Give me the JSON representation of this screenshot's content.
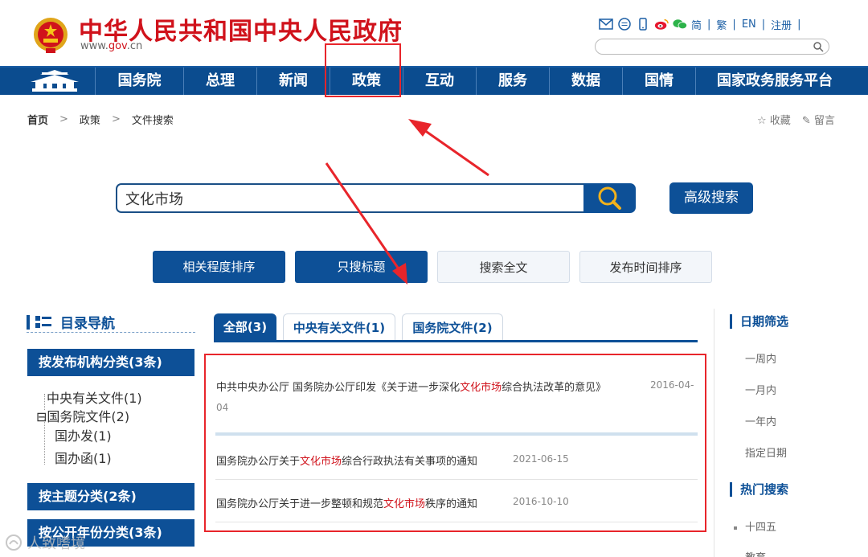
{
  "header": {
    "title": "中华人民共和国中央人民政府",
    "url_prefix": "www.",
    "url_brand": "gov",
    "url_suffix": ".cn",
    "links": {
      "simplified": "简",
      "traditional": "繁",
      "english": "EN",
      "register": "注册"
    },
    "sep": "|",
    "search_placeholder": ""
  },
  "nav": {
    "items": [
      "国务院",
      "总理",
      "新闻",
      "政策",
      "互动",
      "服务",
      "数据",
      "国情",
      "国家政务服务平台"
    ]
  },
  "breadcrumb": {
    "home": "首页",
    "arrow": ">",
    "level1": "政策",
    "level2": "文件搜索"
  },
  "tools": {
    "favorite": "收藏",
    "message": "留言"
  },
  "search": {
    "query": "文化市场",
    "advanced_label": "高级搜索"
  },
  "sort_buttons": [
    "相关程度排序",
    "只搜标题",
    "搜索全文",
    "发布时间排序"
  ],
  "left": {
    "dir_title": "目录导航",
    "cat_org": "按发布机构分类(3条)",
    "tree": {
      "central": "中央有关文件(1)",
      "toggle": "⊟",
      "state_council": "国务院文件(2)",
      "guobanfa": "国办发(1)",
      "guobanhan": "国办函(1)"
    },
    "cat_theme": "按主题分类(2条)",
    "cat_year": "按公开年份分类(3条)"
  },
  "tabs": [
    "全部(3)",
    "中央有关文件(1)",
    "国务院文件(2)"
  ],
  "results": [
    {
      "pre": "中共中央办公厅  国务院办公厅印发《关于进一步深化",
      "hl": "文化市场",
      "post": "综合执法改革的意见》",
      "date_a": "2016-04-",
      "date_b": "04"
    },
    {
      "pre": "国务院办公厅关于",
      "hl": "文化市场",
      "post": "综合行政执法有关事项的通知",
      "date": "2021-06-15"
    },
    {
      "pre": "国务院办公厅关于进一步整顿和规范",
      "hl": "文化市场",
      "post": "秩序的通知",
      "date": "2016-10-10"
    }
  ],
  "right": {
    "date_title": "日期筛选",
    "date_items": [
      "一周内",
      "一月内",
      "一年内",
      "指定日期"
    ],
    "hot_title": "热门搜索",
    "hot_items": [
      "十四五",
      "教育"
    ]
  },
  "watermark": "人致嗜境",
  "colors": {
    "brand_red": "#d0121b",
    "nav_blue": "#0b4c8f",
    "button_blue": "#0d5097",
    "annotation_red": "#e8252b"
  }
}
